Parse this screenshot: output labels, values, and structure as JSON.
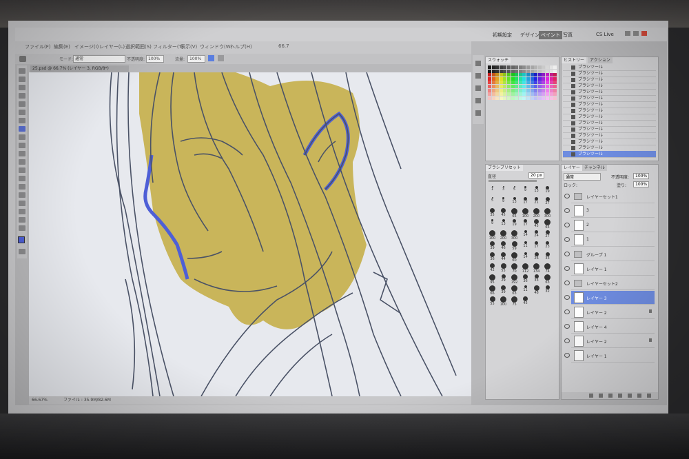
{
  "workspace": {
    "buttons": [
      "初期設定",
      "デザイン",
      "ペイント",
      "写真"
    ],
    "active": "ペイント",
    "cs_live": "CS Live"
  },
  "menu": [
    "ファイル(F)",
    "編集(E)",
    "イメージ(I)",
    "レイヤー(L)",
    "選択範囲(S)",
    "フィルター(T)",
    "表示(V)",
    "ウィンドウ(W)",
    "ヘルプ(H)"
  ],
  "options": {
    "mode_label": "モード:",
    "mode_value": "通常",
    "opacity_label": "不透明度:",
    "opacity_value": "100%",
    "flow_label": "流量:",
    "flow_value": "100%",
    "zoom_display": "66.7"
  },
  "document": {
    "tab": "25.psd @ 66.7% (レイヤー 3, RGB/8*)",
    "status_zoom": "66.67%",
    "status_file": "ファイル : 35.9M/82.6M"
  },
  "swatches_panel": {
    "tab": "スウォッチ"
  },
  "history_panel": {
    "tabs": [
      "ヒストリー",
      "アクション"
    ],
    "rows": [
      "ブラシツール",
      "ブラシツール",
      "ブラシツール",
      "ブラシツール",
      "ブラシツール",
      "ブラシツール",
      "ブラシツール",
      "ブラシツール",
      "ブラシツール",
      "ブラシツール",
      "ブラシツール",
      "ブラシツール",
      "ブラシツール",
      "ブラシツール",
      "ブラシツール"
    ]
  },
  "brush_panel": {
    "tab": "ブラシプリセット",
    "size_label": "直径",
    "size_value": "20 px",
    "sizes": [
      "1",
      "3",
      "5",
      "9",
      "13",
      "19",
      "5",
      "9",
      "13",
      "17",
      "21",
      "27",
      "35",
      "45",
      "65",
      "100",
      "200",
      "300",
      "9",
      "13",
      "19",
      "17",
      "45",
      "65",
      "100",
      "200",
      "300",
      "14",
      "24",
      "27",
      "39",
      "46",
      "59",
      "11",
      "17",
      "23",
      "36",
      "44",
      "60",
      "14",
      "26",
      "33",
      "42",
      "55",
      "70",
      "112",
      "134",
      "74",
      "95",
      "29",
      "192",
      "36",
      "33",
      "63",
      "66",
      "39",
      "63",
      "11",
      "48",
      "32",
      "55",
      "100",
      "75",
      "45"
    ]
  },
  "layers_panel": {
    "tabs": [
      "レイヤー",
      "チャンネル"
    ],
    "blend_mode": "通常",
    "opacity_label": "不透明度:",
    "opacity_value": "100%",
    "lock_label": "ロック:",
    "fill_label": "塗り:",
    "fill_value": "100%",
    "layers": [
      {
        "name": "レイヤーセット1",
        "type": "group"
      },
      {
        "name": "3",
        "type": "layer"
      },
      {
        "name": "2",
        "type": "layer"
      },
      {
        "name": "1",
        "type": "layer"
      },
      {
        "name": "グループ 1",
        "type": "group"
      },
      {
        "name": "レイヤー 1",
        "type": "layer"
      },
      {
        "name": "レイヤーセット2",
        "type": "group"
      },
      {
        "name": "レイヤー 3",
        "type": "layer",
        "selected": true
      },
      {
        "name": "レイヤー 2",
        "type": "layer"
      },
      {
        "name": "レイヤー 4",
        "type": "layer"
      },
      {
        "name": "レイヤー 2",
        "type": "layer"
      },
      {
        "name": "レイヤー 1",
        "type": "layer"
      }
    ]
  },
  "colors": {
    "sketch_line": "#4a5266",
    "flat_fill": "#c9b55a",
    "blue_line": "#4e5fd6",
    "accent_select": "#6e8ce0"
  }
}
